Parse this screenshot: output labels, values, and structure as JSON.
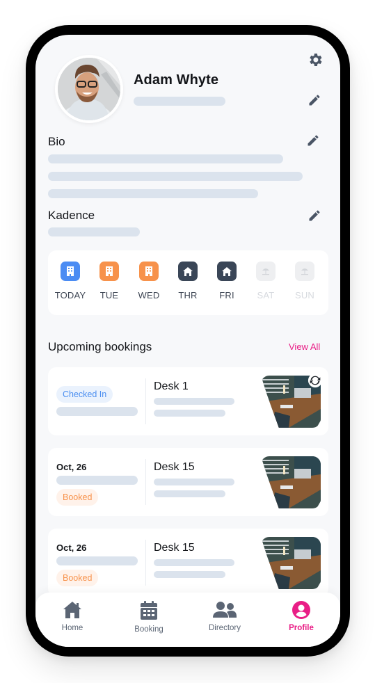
{
  "profile": {
    "name": "Adam Whyte"
  },
  "sections": {
    "bio_title": "Bio",
    "kadence_title": "Kadence"
  },
  "week": {
    "days": [
      {
        "label": "TODAY",
        "icon": "office-building-icon",
        "color": "#4b8cf3",
        "state": "office"
      },
      {
        "label": "TUE",
        "icon": "office-building-icon",
        "color": "#f7924b",
        "state": "office"
      },
      {
        "label": "WED",
        "icon": "office-building-icon",
        "color": "#f7924b",
        "state": "office"
      },
      {
        "label": "THR",
        "icon": "home-icon",
        "color": "#3a4657",
        "state": "home"
      },
      {
        "label": "FRI",
        "icon": "home-icon",
        "color": "#3a4657",
        "state": "home"
      },
      {
        "label": "SAT",
        "icon": "beach-umbrella-icon",
        "color": "#eeeff1",
        "state": "off"
      },
      {
        "label": "SUN",
        "icon": "beach-umbrella-icon",
        "color": "#eeeff1",
        "state": "off"
      }
    ]
  },
  "bookings": {
    "title": "Upcoming bookings",
    "view_all": "View All",
    "items": [
      {
        "status": "Checked In",
        "date": "",
        "desk": "Desk 1",
        "status_type": "checked"
      },
      {
        "status": "Booked",
        "date": "Oct, 26",
        "desk": "Desk 15",
        "status_type": "booked"
      },
      {
        "status": "Booked",
        "date": "Oct, 26",
        "desk": "Desk 15",
        "status_type": "booked"
      }
    ]
  },
  "nav": {
    "items": [
      {
        "label": "Home",
        "icon": "home-icon",
        "active": false
      },
      {
        "label": "Booking",
        "icon": "calendar-icon",
        "active": false
      },
      {
        "label": "Directory",
        "icon": "users-icon",
        "active": false
      },
      {
        "label": "Profile",
        "icon": "user-circle-icon",
        "active": true
      }
    ]
  },
  "colors": {
    "accent": "#e91e86",
    "skeleton": "#dbe3ed",
    "icon_gray": "#4a5565"
  }
}
